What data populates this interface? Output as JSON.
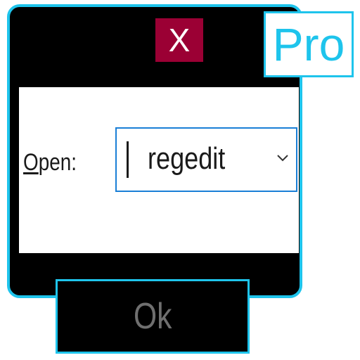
{
  "dialog": {
    "close_label": "X",
    "badge_text": "Pro"
  },
  "run": {
    "open_label_mnemonic": "O",
    "open_label_rest": "pen:",
    "input_value": "regedit",
    "dropdown_icon": "chevron-down-icon"
  },
  "actions": {
    "ok_label": "Ok"
  },
  "colors": {
    "frame_border": "#1ec4ec",
    "close_background": "#9b0034",
    "input_focus_border": "#1a7fd6",
    "ok_text": "#6f6f6f"
  }
}
